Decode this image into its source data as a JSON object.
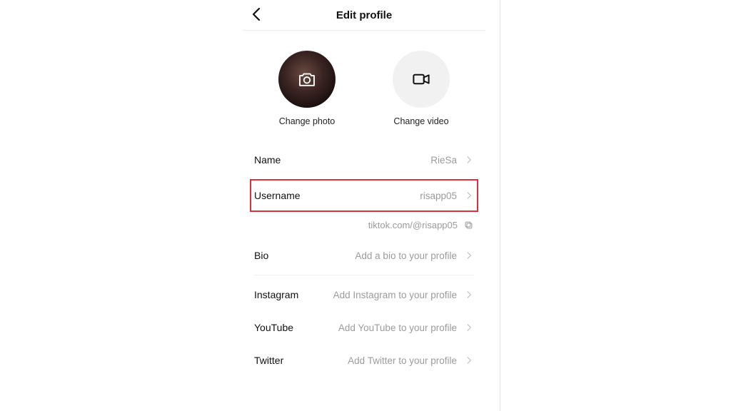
{
  "header": {
    "title": "Edit profile"
  },
  "media": {
    "change_photo_label": "Change photo",
    "change_video_label": "Change video"
  },
  "rows": {
    "name": {
      "label": "Name",
      "value": "RieSa"
    },
    "username": {
      "label": "Username",
      "value": "risapp05"
    },
    "bio": {
      "label": "Bio",
      "value": "Add a bio to your profile"
    },
    "instagram": {
      "label": "Instagram",
      "value": "Add Instagram to your profile"
    },
    "youtube": {
      "label": "YouTube",
      "value": "Add YouTube to your profile"
    },
    "twitter": {
      "label": "Twitter",
      "value": "Add Twitter to your profile"
    }
  },
  "profile_url": "tiktok.com/@risapp05",
  "highlight_row": "username",
  "chart_data": null
}
